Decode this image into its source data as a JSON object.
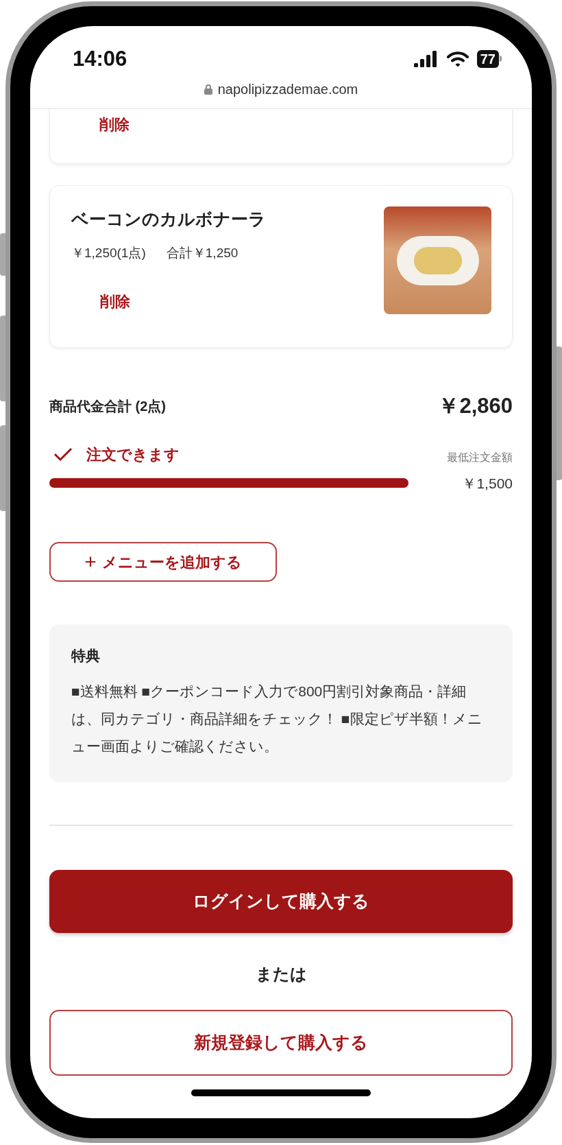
{
  "status_bar": {
    "time": "14:06",
    "battery": "77"
  },
  "address_bar": {
    "url": "napolipizzademae.com"
  },
  "cart_items": [
    {
      "delete_label": "削除"
    },
    {
      "name": "ベーコンのカルボナーラ",
      "unit_price": "￥1,250(1点)",
      "subtotal": "合計￥1,250",
      "delete_label": "削除"
    }
  ],
  "total": {
    "label": "商品代金合計 (2点)",
    "amount": "￥2,860"
  },
  "minimum_order": {
    "status": "注文できます",
    "ok": true,
    "label": "最低注文金額",
    "amount": "￥1,500",
    "level": 1
  },
  "add_menu_button": {
    "icon": "+",
    "label": "メニューを追加する"
  },
  "benefits": {
    "title": "特典",
    "text": "■送料無料 ■クーポンコード入力で800円割引対象商品・詳細は、同カテゴリ・商品詳細をチェック！ ■限定ピザ半額！メニュー画面よりご確認ください。"
  },
  "actions": {
    "login": "ログインして購入する",
    "or": "または",
    "signup": "新規登録して購入する"
  }
}
